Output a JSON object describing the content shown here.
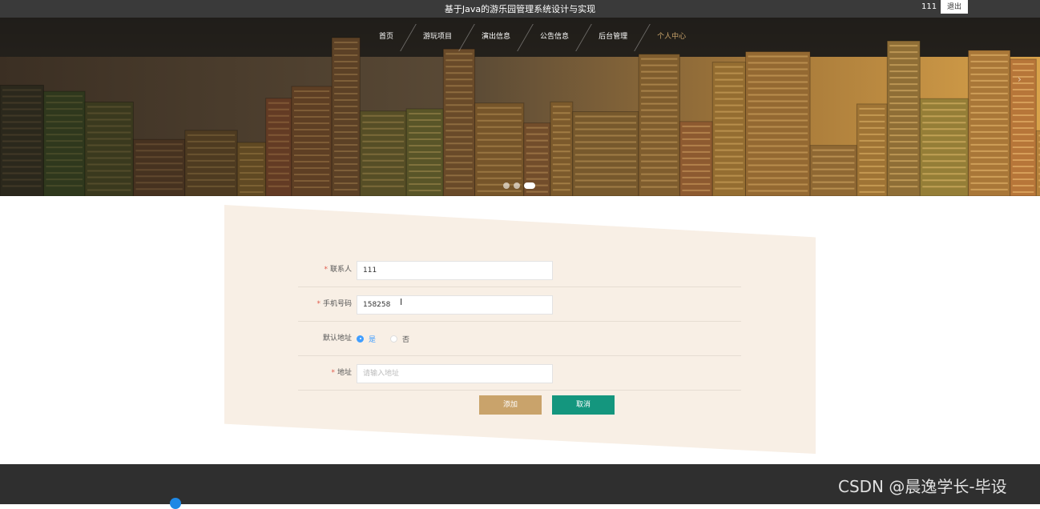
{
  "header": {
    "title": "基于Java的游乐园管理系统设计与实现",
    "username": "111",
    "logout_label": "退出"
  },
  "nav": {
    "items": [
      "首页",
      "游玩项目",
      "演出信息",
      "公告信息",
      "后台管理",
      "个人中心"
    ],
    "active_index": 5
  },
  "carousel": {
    "slide_count": 3,
    "active_index": 2
  },
  "form": {
    "contact": {
      "label": "联系人",
      "required": true,
      "value": "111"
    },
    "phone": {
      "label": "手机号码",
      "required": true,
      "value": "158258"
    },
    "default_address": {
      "label": "默认地址",
      "options": [
        "是",
        "否"
      ],
      "selected": "是"
    },
    "address": {
      "label": "地址",
      "required": true,
      "value": "",
      "placeholder": "请输入地址"
    },
    "add_label": "添加",
    "cancel_label": "取消"
  },
  "watermark": "CSDN @晨逸学长-毕设",
  "colors": {
    "accent": "#c9a36b",
    "cancel": "#14967e",
    "panel": "#f8efe5",
    "topbar": "#3a3a3a"
  }
}
